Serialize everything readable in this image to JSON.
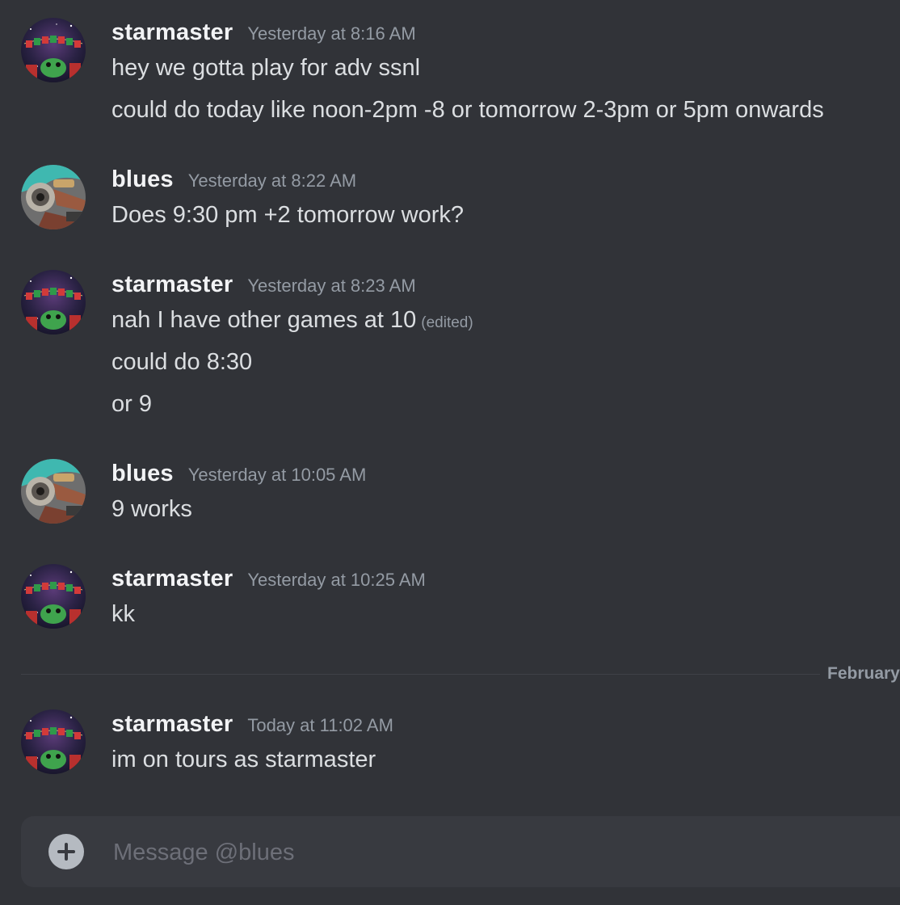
{
  "messages": [
    {
      "author": "starmaster",
      "timestamp": "Yesterday at 8:16 AM",
      "avatar": "starmaster-avatar",
      "lines": [
        "hey we gotta play for adv ssnl",
        "could do today like noon-2pm -8 or tomorrow 2-3pm or 5pm onwards"
      ]
    },
    {
      "author": "blues",
      "timestamp": "Yesterday at 8:22 AM",
      "avatar": "blues-avatar",
      "lines": [
        "Does 9:30 pm +2 tomorrow work?"
      ]
    },
    {
      "author": "starmaster",
      "timestamp": "Yesterday at 8:23 AM",
      "avatar": "starmaster-avatar",
      "lines": [
        "nah I have other games at 10",
        "could do 8:30",
        "or 9"
      ],
      "edited_label": "(edited)"
    },
    {
      "author": "blues",
      "timestamp": "Yesterday at 10:05 AM",
      "avatar": "blues-avatar",
      "lines": [
        "9 works"
      ]
    },
    {
      "author": "starmaster",
      "timestamp": "Yesterday at 10:25 AM",
      "avatar": "starmaster-avatar",
      "lines": [
        "kk"
      ]
    },
    {
      "author": "starmaster",
      "timestamp": "Today at 11:02 AM",
      "avatar": "starmaster-avatar",
      "lines": [
        "im on tours as starmaster"
      ]
    }
  ],
  "date_divider": {
    "label": "February"
  },
  "composer": {
    "placeholder": "Message @blues",
    "add_icon": "plus-circle-icon"
  },
  "colors": {
    "background": "#313338",
    "composer_background": "#383a40",
    "username": "#f2f3f5",
    "timestamp": "#949ba4",
    "message_text": "#dbdee1"
  }
}
